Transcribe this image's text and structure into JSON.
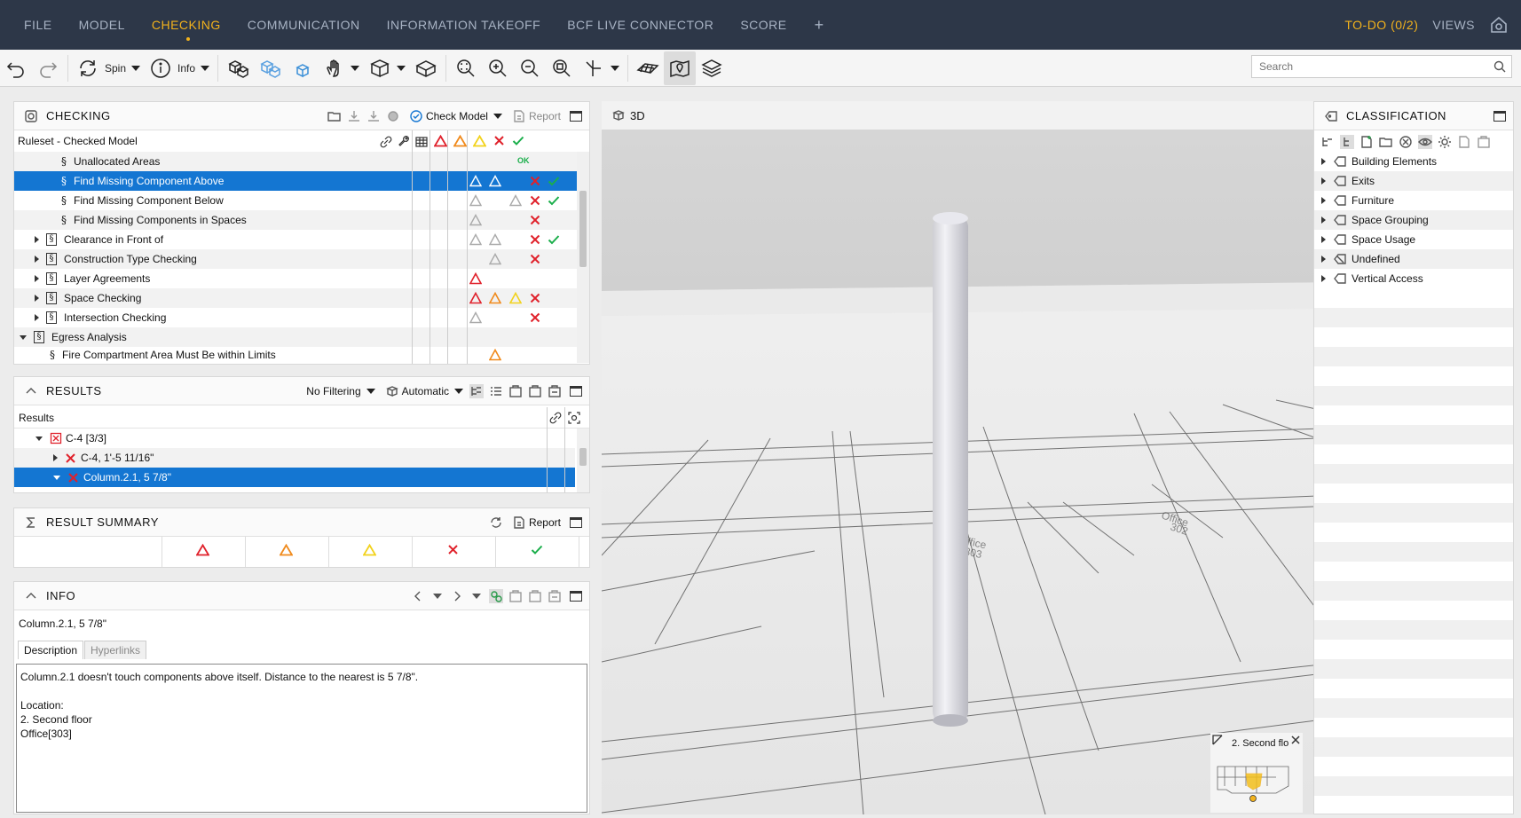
{
  "nav": {
    "items": [
      "FILE",
      "MODEL",
      "CHECKING",
      "COMMUNICATION",
      "INFORMATION TAKEOFF",
      "BCF LIVE CONNECTOR",
      "SCORE"
    ],
    "active": "CHECKING",
    "plus": "+",
    "todo": "TO-DO (0/2)",
    "views": "VIEWS"
  },
  "toolbar": {
    "spin_label": "Spin",
    "info_label": "Info",
    "search_placeholder": "Search"
  },
  "checking": {
    "title": "CHECKING",
    "check_model_label": "Check Model",
    "report_label": "Report",
    "ruleset_label": "Ruleset - Checked Model",
    "ok_label": "OK",
    "rows": [
      {
        "label": "Unallocated Areas"
      },
      {
        "label": "Find Missing Component Above"
      },
      {
        "label": "Find Missing Component Below"
      },
      {
        "label": "Find Missing Components in Spaces"
      },
      {
        "label": "Clearance  in Front of"
      },
      {
        "label": "Construction Type Checking"
      },
      {
        "label": "Layer Agreements"
      },
      {
        "label": "Space Checking"
      },
      {
        "label": "Intersection Checking"
      },
      {
        "label": "Egress Analysis"
      },
      {
        "label": "Fire Compartment Area Must Be within Limits"
      }
    ]
  },
  "results": {
    "title": "RESULTS",
    "filter_label": "No Filtering",
    "auto_label": "Automatic",
    "header_label": "Results",
    "rows": [
      {
        "label": "C-4 [3/3]"
      },
      {
        "label": "C-4, 1'-5 11/16\""
      },
      {
        "label": "Column.2.1, 5 7/8\""
      }
    ]
  },
  "summary": {
    "title": "RESULT  SUMMARY",
    "report_label": "Report"
  },
  "info": {
    "title": "INFO",
    "selected_name": "Column.2.1, 5 7/8\"",
    "tab_description": "Description",
    "tab_hyperlinks": "Hyperlinks",
    "description": "Column.2.1 doesn't touch components above itself. Distance to the nearest is 5 7/8\".\n\nLocation:\n2. Second floor\nOffice[303]"
  },
  "view3d": {
    "title": "3D",
    "floor_label": "2. Second flo",
    "room_label_1": "Office",
    "room_number_1": "303",
    "room_label_2": "Office",
    "room_number_2": "302"
  },
  "classification": {
    "title": "CLASSIFICATION",
    "items": [
      "Building Elements",
      "Exits",
      "Furniture",
      "Space Grouping",
      "Space Usage",
      "Undefined",
      "Vertical Access"
    ]
  },
  "colors": {
    "nav_bg": "#2d3748",
    "accent": "#f2b21c",
    "selection": "#1476d2",
    "critical": "#e0212b",
    "moderate": "#f08a1c",
    "minor": "#f2d21c",
    "ok": "#1aae4a"
  }
}
